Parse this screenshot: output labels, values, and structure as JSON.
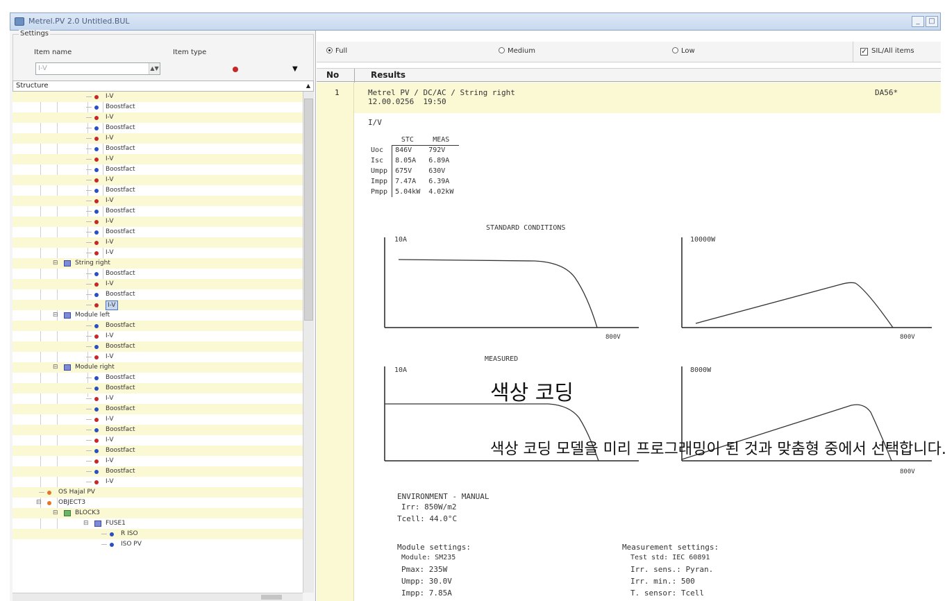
{
  "window": {
    "title": "Metrel.PV 2.0 Untitled.BUL",
    "minimize": "_",
    "restore": "□"
  },
  "left_panel": {
    "settings_legend": "Settings",
    "item_name_label": "Item name",
    "item_type_label": "Item type",
    "item_name_value": "I-V",
    "structure_label": "Structure",
    "tree": [
      {
        "label": "I-V",
        "indent": 3,
        "marker": "red-dot"
      },
      {
        "label": "Boostfact",
        "indent": 3,
        "marker": "blue-dot"
      },
      {
        "label": "I-V",
        "indent": 3,
        "marker": "red-dot"
      },
      {
        "label": "Boostfact",
        "indent": 3,
        "marker": "blue-dot"
      },
      {
        "label": "I-V",
        "indent": 3,
        "marker": "red-dot"
      },
      {
        "label": "Boostfact",
        "indent": 3,
        "marker": "blue-dot"
      },
      {
        "label": "I-V",
        "indent": 3,
        "marker": "red-dot"
      },
      {
        "label": "Boostfact",
        "indent": 3,
        "marker": "blue-dot"
      },
      {
        "label": "I-V",
        "indent": 3,
        "marker": "red-dot"
      },
      {
        "label": "Boostfact",
        "indent": 3,
        "marker": "blue-dot"
      },
      {
        "label": "I-V",
        "indent": 3,
        "marker": "red-dot"
      },
      {
        "label": "Boostfact",
        "indent": 3,
        "marker": "blue-dot"
      },
      {
        "label": "I-V",
        "indent": 3,
        "marker": "red-dot"
      },
      {
        "label": "Boostfact",
        "indent": 3,
        "marker": "blue-dot"
      },
      {
        "label": "I-V",
        "indent": 3,
        "marker": "red-dot"
      },
      {
        "label": "I-V",
        "indent": 3,
        "marker": "red-dot"
      },
      {
        "label": "String right",
        "indent": 2,
        "marker": "folder",
        "expander": "-"
      },
      {
        "label": "Boostfact",
        "indent": 3,
        "marker": "blue-dot"
      },
      {
        "label": "I-V",
        "indent": 3,
        "marker": "red-dot"
      },
      {
        "label": "Boostfact",
        "indent": 3,
        "marker": "blue-dot"
      },
      {
        "label": "I-V",
        "indent": 3,
        "marker": "red-dot",
        "selected": true
      },
      {
        "label": "Module left",
        "indent": 2,
        "marker": "folder",
        "expander": "-"
      },
      {
        "label": "Boostfact",
        "indent": 3,
        "marker": "blue-dot"
      },
      {
        "label": "I-V",
        "indent": 3,
        "marker": "red-dot"
      },
      {
        "label": "Boostfact",
        "indent": 3,
        "marker": "blue-dot"
      },
      {
        "label": "I-V",
        "indent": 3,
        "marker": "red-dot"
      },
      {
        "label": "Module right",
        "indent": 2,
        "marker": "folder",
        "expander": "-"
      },
      {
        "label": "Boostfact",
        "indent": 3,
        "marker": "blue-dot"
      },
      {
        "label": "Boostfact",
        "indent": 3,
        "marker": "blue-dot"
      },
      {
        "label": "I-V",
        "indent": 3,
        "marker": "red-dot"
      },
      {
        "label": "Boostfact",
        "indent": 3,
        "marker": "blue-dot"
      },
      {
        "label": "I-V",
        "indent": 3,
        "marker": "red-dot"
      },
      {
        "label": "Boostfact",
        "indent": 3,
        "marker": "blue-dot"
      },
      {
        "label": "I-V",
        "indent": 3,
        "marker": "red-dot"
      },
      {
        "label": "Boostfact",
        "indent": 3,
        "marker": "blue-dot"
      },
      {
        "label": "I-V",
        "indent": 3,
        "marker": "red-dot"
      },
      {
        "label": "Boostfact",
        "indent": 3,
        "marker": "blue-dot"
      },
      {
        "label": "I-V",
        "indent": 3,
        "marker": "red-dot"
      },
      {
        "label": "OS Hajal PV",
        "indent": 1,
        "marker": "orange-dot"
      },
      {
        "label": "OBJECT3",
        "indent": 1,
        "marker": "orange-dot",
        "expander": "-"
      },
      {
        "label": "BLOCK3",
        "indent": 2,
        "marker": "green-folder",
        "expander": "-"
      },
      {
        "label": "FUSE1",
        "indent": 3,
        "marker": "folder",
        "expander": "-"
      },
      {
        "label": "R ISO",
        "indent": 4,
        "marker": "blue-dot"
      },
      {
        "label": "ISO PV",
        "indent": 4,
        "marker": "blue-dot"
      }
    ]
  },
  "mode_bar": {
    "full": "Full",
    "medium": "Medium",
    "low": "Low",
    "selected": "full",
    "checkbox_label": "SIL/All items",
    "checkbox_mark": "✓"
  },
  "results_header": {
    "no": "No",
    "results": "Results"
  },
  "result": {
    "number": "1",
    "line1": "Metrel PV / DC/AC / String right",
    "line2": "12.00.0256  19:50",
    "code": "DA56*",
    "iv_label": "I/V",
    "table": {
      "col_stc": "STC",
      "col_meas": "MEAS",
      "rows": [
        {
          "param": "Uoc",
          "stc": "846V",
          "meas": "792V"
        },
        {
          "param": "Isc",
          "stc": "8.05A",
          "meas": "6.89A"
        },
        {
          "param": "Umpp",
          "stc": "675V",
          "meas": "630V"
        },
        {
          "param": "Impp",
          "stc": "7.47A",
          "meas": "6.39A"
        },
        {
          "param": "Pmpp",
          "stc": "5.04kW",
          "meas": "4.02kW"
        }
      ]
    },
    "standard_title": "STANDARD CONDITIONS",
    "measured_title": "MEASURED",
    "std_iv": {
      "ymax": "10A",
      "xmax": "800V"
    },
    "std_pv": {
      "ymax": "10000W",
      "xmax": "800V"
    },
    "meas_iv": {
      "ymax": "10A",
      "xmax": "800V"
    },
    "meas_pv": {
      "ymax": "8000W",
      "xmax": "800V"
    },
    "environment": {
      "title": "ENVIRONMENT - MANUAL",
      "irr": "Irr: 850W/m2",
      "tcell": "Tcell: 44.0°C"
    },
    "module_settings": {
      "title": "Module settings:",
      "module": "Module: SM235",
      "pmax": "Pmax: 235W",
      "umpp": "Umpp: 30.0V",
      "impp": "Impp: 7.85A"
    },
    "measurement_settings": {
      "title": "Measurement settings:",
      "test_std": "Test std: IEC 60891",
      "irr_sens": "Irr. sens.: Pyran.",
      "irr_min": "Irr. min.: 500",
      "t_sensor": "T. sensor: Tcell"
    }
  },
  "overlay": {
    "title": "색상 코딩",
    "text": "색상 코딩 모델을 미리 프로그래밍이 된 것과 맞춤형 중에서 선택합니다."
  },
  "colors": {
    "tree_alt_row": "#fbf8d4",
    "dot_red": "#c62828",
    "dot_blue": "#2a4fc0",
    "titlebar": "#c8d9ef"
  }
}
